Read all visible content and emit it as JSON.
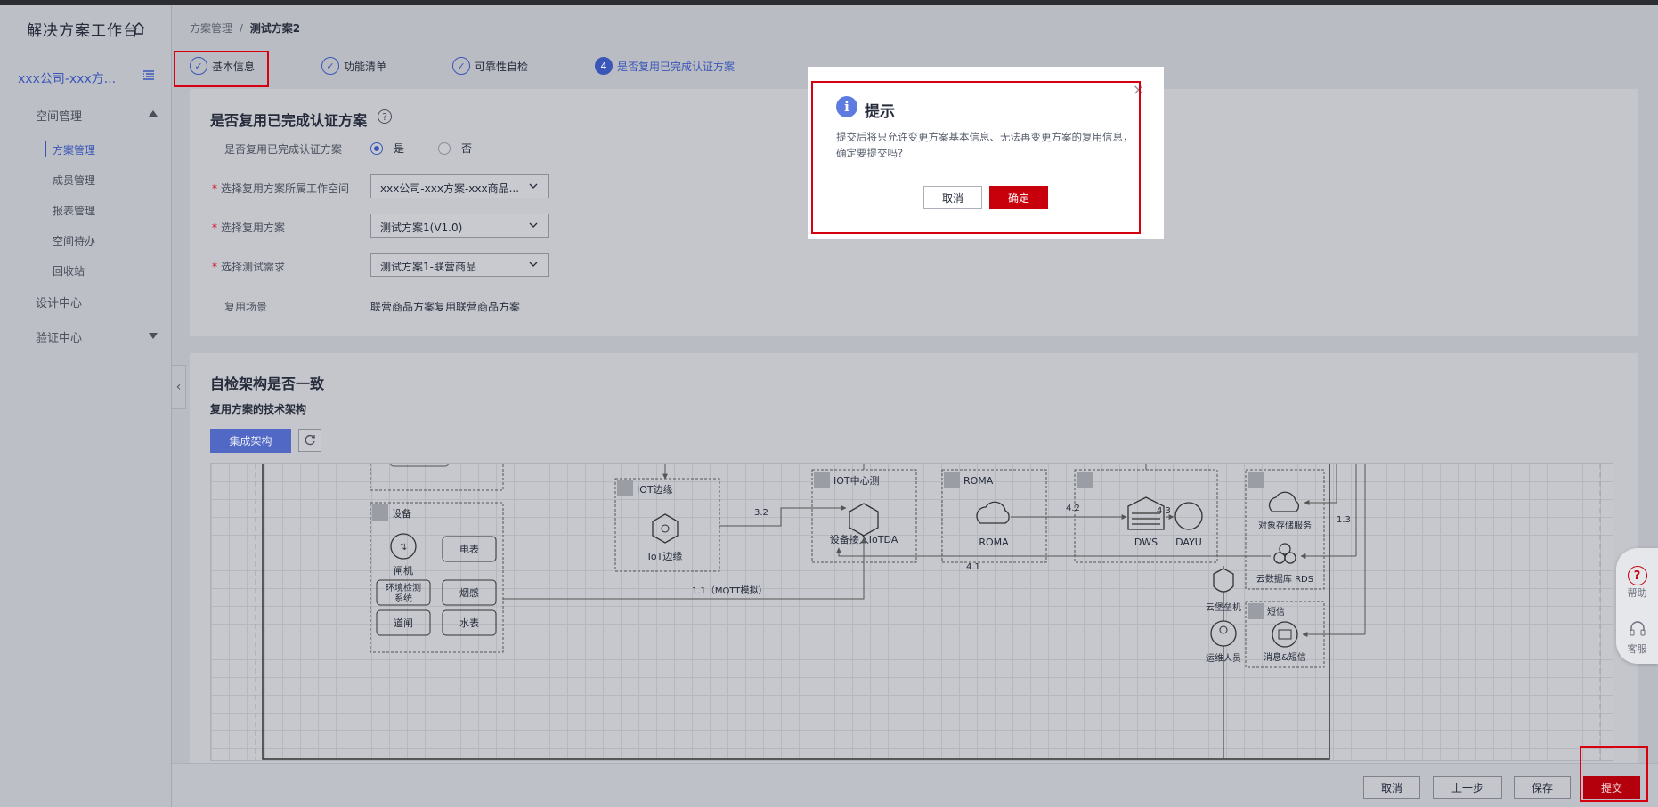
{
  "sidebar": {
    "title": "解决方案工作台",
    "workspace": "xxx公司-xxx方...",
    "groups": [
      {
        "label": "空间管理"
      },
      {
        "label": "设计中心"
      },
      {
        "label": "验证中心"
      }
    ],
    "subitems": [
      "方案管理",
      "成员管理",
      "报表管理",
      "空间待办",
      "回收站"
    ]
  },
  "breadcrumb": {
    "root": "方案管理",
    "sep": "/",
    "current": "测试方案2"
  },
  "steps": [
    {
      "label": "基本信息",
      "mark": "✓"
    },
    {
      "label": "功能清单",
      "mark": "✓"
    },
    {
      "label": "可靠性自检",
      "mark": "✓"
    },
    {
      "label": "是否复用已完成认证方案",
      "mark": "4"
    }
  ],
  "reuse": {
    "title": "是否复用已完成认证方案",
    "help_icon": "?",
    "q_label": "是否复用已完成认证方案",
    "opt_yes": "是",
    "opt_no": "否",
    "ws_label": "选择复用方案所属工作空间",
    "ws_value": "xxx公司-xxx方案-xxx商品...",
    "plan_label": "选择复用方案",
    "plan_value": "测试方案1(V1.0)",
    "req_label": "选择测试需求",
    "req_value": "测试方案1-联营商品",
    "scene_label": "复用场景",
    "scene_value": "联营商品方案复用联营商品方案"
  },
  "arch": {
    "title": "自检架构是否一致",
    "subtitle": "复用方案的技术架构",
    "integrate_btn": "集成架构"
  },
  "diagram": {
    "device_group": "设备",
    "gate": "闸机",
    "meter": "电表",
    "env": "环境检测",
    "env2": "系统",
    "smoke": "烟感",
    "barrier": "道闸",
    "water": "水表",
    "iot_edge_group": "IOT边缘",
    "iot_edge": "IoT边缘",
    "iot_center_group": "IOT中心测",
    "iotda": "设备接入IoTDA",
    "roma_group": "ROMA",
    "roma": "ROMA",
    "dws": "DWS",
    "dayu": "DAYU",
    "obs": "对象存储服务",
    "rds": "云数据库 RDS",
    "bastion": "云堡垒机",
    "ops": "运维人员",
    "sms_group": "短信",
    "sms": "消息&短信",
    "e32": "3.2",
    "e11": "1.1（MQTT模拟）",
    "e42": "4.2",
    "e43": "4.3",
    "e41": "4.1",
    "e13": "1.3"
  },
  "float_help": {
    "help": "帮助",
    "service": "客服"
  },
  "bottom": {
    "cancel": "取消",
    "prev": "上一步",
    "save": "保存",
    "submit": "提交"
  },
  "modal": {
    "title": "提示",
    "info": "i",
    "text": "提交后将只允许变更方案基本信息、无法再变更方案的复用信息，确定要提交吗?",
    "cancel": "取消",
    "ok": "确定",
    "close": "×"
  },
  "colors": {
    "accent": "#5e7ce0",
    "danger": "#c7000b",
    "highlight": "#d7000f"
  }
}
